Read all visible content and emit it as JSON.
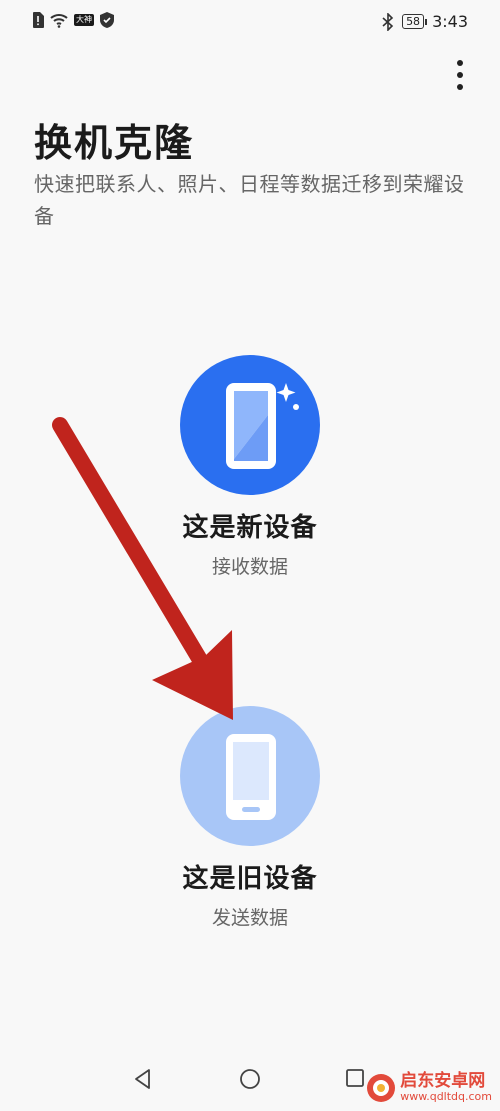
{
  "status_bar": {
    "badge_text": "大神",
    "battery": "58",
    "time": "3:43"
  },
  "page": {
    "title": "换机克隆",
    "subtitle": "快速把联系人、照片、日程等数据迁移到荣耀设备"
  },
  "options": [
    {
      "title": "这是新设备",
      "subtitle": "接收数据"
    },
    {
      "title": "这是旧设备",
      "subtitle": "发送数据"
    }
  ],
  "watermark": {
    "name": "启东安卓网",
    "url": "www.qdltdq.com"
  },
  "colors": {
    "new_device_circle": "#2a6ff0",
    "old_device_circle": "#a8c6f7",
    "annotation_arrow": "#c0241d"
  }
}
